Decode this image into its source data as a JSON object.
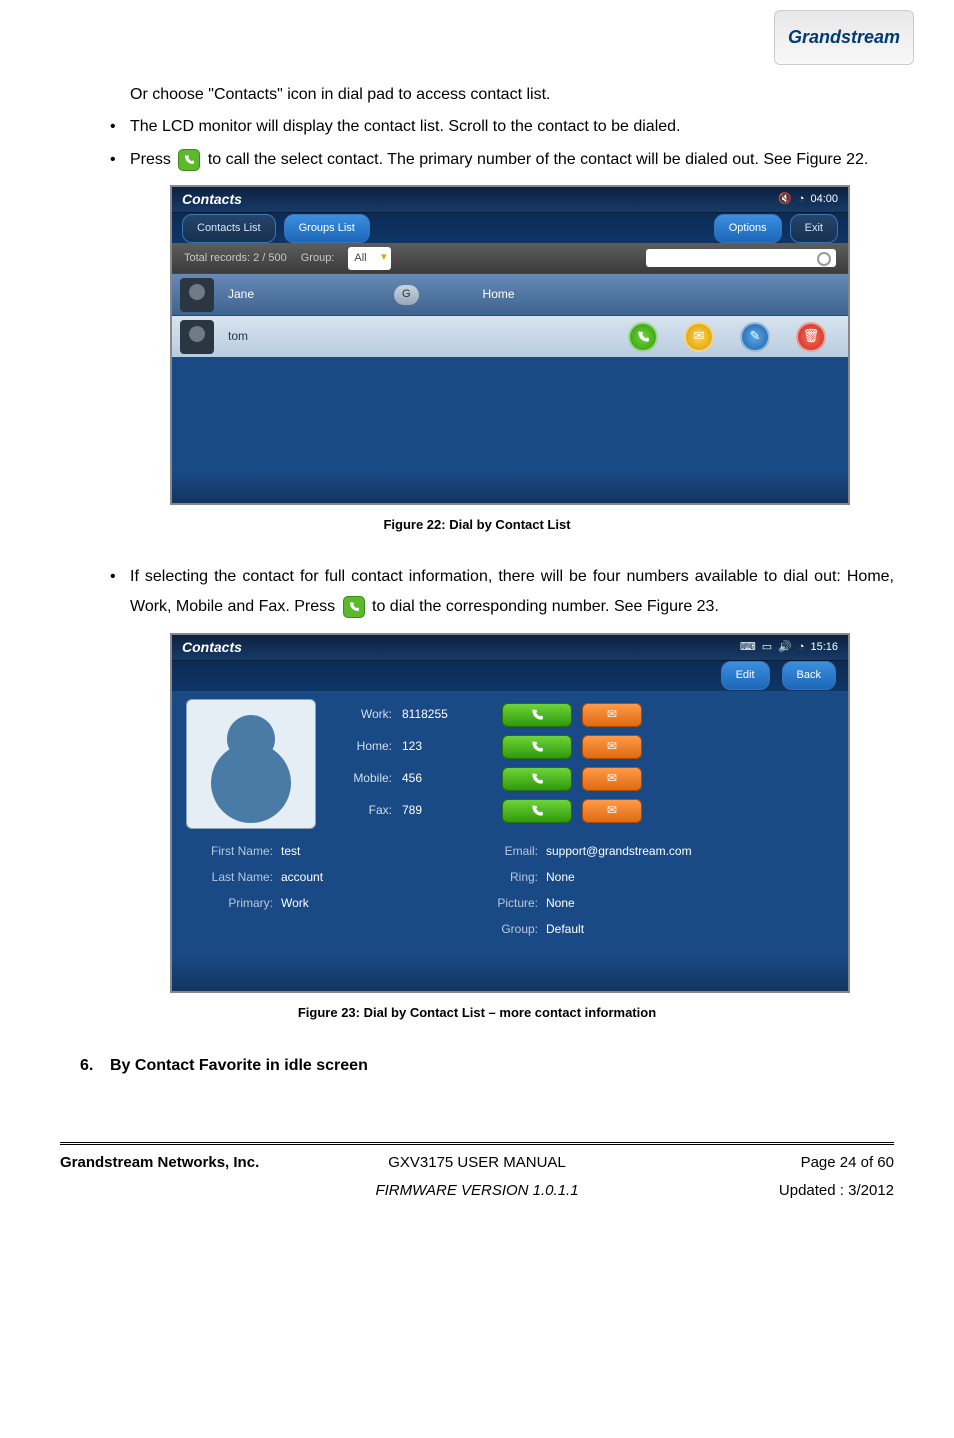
{
  "brand": "Grandstream",
  "body": {
    "line_top": "Or choose \"Contacts\" icon in dial pad to access contact list.",
    "bullet1": "The LCD monitor will display the contact list. Scroll to the contact to be dialed.",
    "bullet2a": "Press",
    "bullet2b": "to call the select contact. The primary number of the contact will be dialed out. See Figure 22.",
    "bullet3a": "If selecting the contact for full contact information, there will be four numbers available to dial out: Home, Work, Mobile and Fax. Press",
    "bullet3b": "to dial the corresponding number. See Figure 23.",
    "fig22_cap": "Figure 22: Dial by Contact List",
    "fig23_cap": "Figure 23: Dial by Contact List – more contact information",
    "heading6_num": "6.",
    "heading6": "By Contact Favorite in idle screen"
  },
  "fig22": {
    "title": "Contacts",
    "time": "04:00",
    "tab1": "Contacts List",
    "tab2": "Groups List",
    "btn_options": "Options",
    "btn_exit": "Exit",
    "total": "Total records: 2 / 500",
    "group_label": "Group:",
    "group_value": "All",
    "rows": [
      {
        "name": "Jane",
        "badge": "G",
        "tag": "Home"
      },
      {
        "name": "tom",
        "badge": "",
        "tag": ""
      }
    ]
  },
  "fig23": {
    "title": "Contacts",
    "time": "15:16",
    "btn_edit": "Edit",
    "btn_back": "Back",
    "nums": [
      {
        "label": "Work:",
        "value": "8118255"
      },
      {
        "label": "Home:",
        "value": "123"
      },
      {
        "label": "Mobile:",
        "value": "456"
      },
      {
        "label": "Fax:",
        "value": "789"
      }
    ],
    "fields_left": [
      {
        "label": "First Name:",
        "value": "test"
      },
      {
        "label": "Last Name:",
        "value": "account"
      },
      {
        "label": "Primary:",
        "value": "Work"
      }
    ],
    "fields_right": [
      {
        "label": "Email:",
        "value": "support@grandstream.com"
      },
      {
        "label": "Ring:",
        "value": "None"
      },
      {
        "label": "Picture:",
        "value": "None"
      },
      {
        "label": "Group:",
        "value": "Default"
      }
    ]
  },
  "footer": {
    "company": "Grandstream Networks, Inc.",
    "manual": "GXV3175 USER MANUAL",
    "page": "Page 24 of 60",
    "firmware": "FIRMWARE VERSION 1.0.1.1",
    "updated": "Updated : 3/2012"
  }
}
